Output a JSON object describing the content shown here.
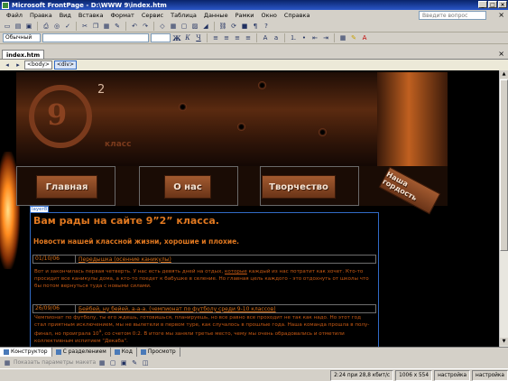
{
  "window": {
    "title": "Microsoft FrontPage - D:\\WWW 9\\index.htm"
  },
  "menubar": {
    "items": [
      "Файл",
      "Правка",
      "Вид",
      "Вставка",
      "Формат",
      "Сервис",
      "Таблица",
      "Данные",
      "Рамки",
      "Окно",
      "Справка"
    ],
    "help_placeholder": "Введите вопрос"
  },
  "format_toolbar": {
    "style_value": "Обычный"
  },
  "document_tab": {
    "label": "index.htm"
  },
  "tag_selector": {
    "tags": [
      "<body>",
      "<div>"
    ]
  },
  "page": {
    "logo": {
      "number": "9",
      "superscript": "2",
      "word": "класс"
    },
    "nav": {
      "home": "Главная",
      "about": "О нас",
      "creative": "Творчество",
      "pride": "Наша гордость"
    },
    "layer_label": "layer8",
    "title": "Вам рады на сайте 9”2” класса.",
    "subtitle": "Новости нашей классной жизни, хорошие и плохие.",
    "news": [
      {
        "date": "01/10/06",
        "caption": "Передышка (осенние каникулы)",
        "body_before": "Вот и закончилась первая четверть. У нас есть девять дней на отдых, ",
        "body_link": "которые",
        "body_after": " каждый из нас потратит как хочет. Кто-то просидит все каникулы дома, а кто-то поедет к бабушке в селение. Но главная цель каждого - это отдохнуть от школы что бы потом вернуться туда с новыми силами."
      },
      {
        "date": "26/09/06",
        "caption_before": "Бейбей, ну ",
        "caption_link": "бейей",
        "caption_after": ", а-а-а. (чемпионат по футболу среди 9-10 классов)",
        "body_before": "Чемпионат по футболу, ты его ждешь, готовишься, планируешь, но все равно все проходит не так как надо. Но этот год стал приятным исключением, мы не вылетели в первом туре, как случалось в прошлые года. Наша команда прошла в полу-финал, но проиграла 10",
        "body_sup": "а",
        "body_after": ", со счетом 0:2. В итоге мы заняли третье место, чему мы очень обрадовались и отметили коллективным испитием \"Декаба\"."
      }
    ]
  },
  "view_tabs": [
    "Конструктор",
    "С разделением",
    "Код",
    "Просмотр"
  ],
  "bottom_toolbar": {
    "show_params": "Показать параметры макета"
  },
  "status": {
    "speed": "2:24 при 28,8 кбит/с",
    "size": "1006 x 554",
    "mode1": "настройка",
    "mode2": "настройка"
  }
}
